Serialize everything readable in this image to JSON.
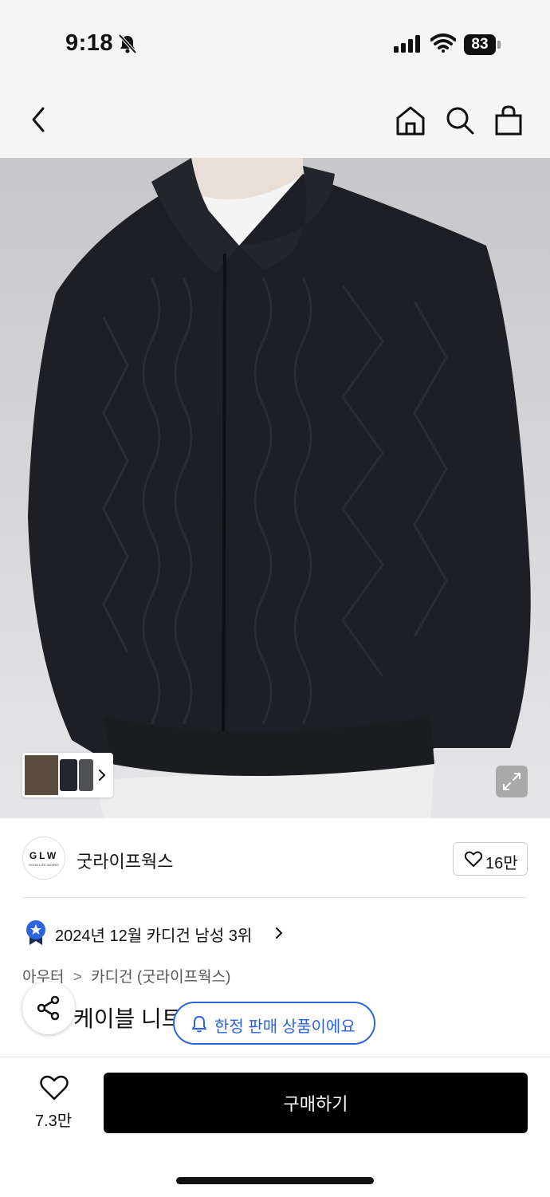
{
  "status_bar": {
    "time": "9:18",
    "battery": "83"
  },
  "nav": {
    "back_icon": "chevron-left-icon",
    "home_icon": "home-icon",
    "search_icon": "search-icon",
    "cart_icon": "shopping-bag-icon"
  },
  "product": {
    "image_icon_name": "cable-knit-zip-cardigan-photo",
    "thumbnail_icon_name": "thumbnail-gallery"
  },
  "brand": {
    "logo_text": "GLW",
    "logo_subtext": "GOOD LIFE WORKS",
    "name": "굿라이프웍스",
    "like_count": "16만"
  },
  "ranking": {
    "text": "2024년 12월 카디건 남성 3위"
  },
  "breadcrumb": {
    "items": [
      "아우터",
      "카디건 (굿라이프웍스)"
    ],
    "separator": ">"
  },
  "title": {
    "text": "케이블 니트"
  },
  "limited_notice": {
    "text": "한정 판매 상품이에요"
  },
  "bottom_bar": {
    "wish_count": "7.3만",
    "buy_label": "구매하기"
  },
  "colors": {
    "accent_blue": "#2c64e0",
    "buy_button": "#000000"
  }
}
